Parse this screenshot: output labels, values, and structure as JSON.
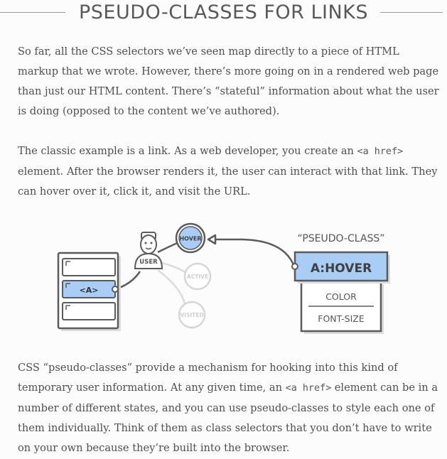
{
  "heading": "PSEUDO-CLASSES FOR LINKS",
  "paragraphs": {
    "p1": "So far, all the CSS selectors we’ve seen map directly to a piece of HTML markup that we wrote. However, there’s more going on in a rendered web page than just our HTML content. There’s “stateful” information about what the user is doing (opposed to the content we’ve authored).",
    "p2_before": "The classic example is a link. As a web developer, you create an ",
    "p2_code": "<a href>",
    "p2_after": " element. After the browser renders it, the user can interact with that link. They can hover over it, click it, and visit the URL.",
    "p3_before": "CSS “pseudo-classes” provide a mechanism for hooking into this kind of temporary user information. At any given time, an ",
    "p3_code": "<a href>",
    "p3_after": " element can be in a number of different states, and you can use pseudo-classes to style each one of them individually. Think of them as class selectors that you don’t have to write on your own because they’re built into the browser."
  },
  "diagram": {
    "pseudo_class_caption": "“PSEUDO-CLASS”",
    "selector_label": "A:HOVER",
    "properties": [
      "COLOR",
      "FONT-SIZE"
    ],
    "link_element_label": "<A>",
    "user_label": "USER",
    "states": {
      "hover": "HOVER",
      "active": "ACTIVE",
      "visited": "VISITED"
    },
    "colors": {
      "highlight": "#a9cdf5",
      "highlight_stroke": "#5a5a5a",
      "muted": "#d6d6d6",
      "muted_text": "#cfcfcf",
      "line": "#5b5b5b",
      "shadow": "#dcdcdc"
    }
  }
}
